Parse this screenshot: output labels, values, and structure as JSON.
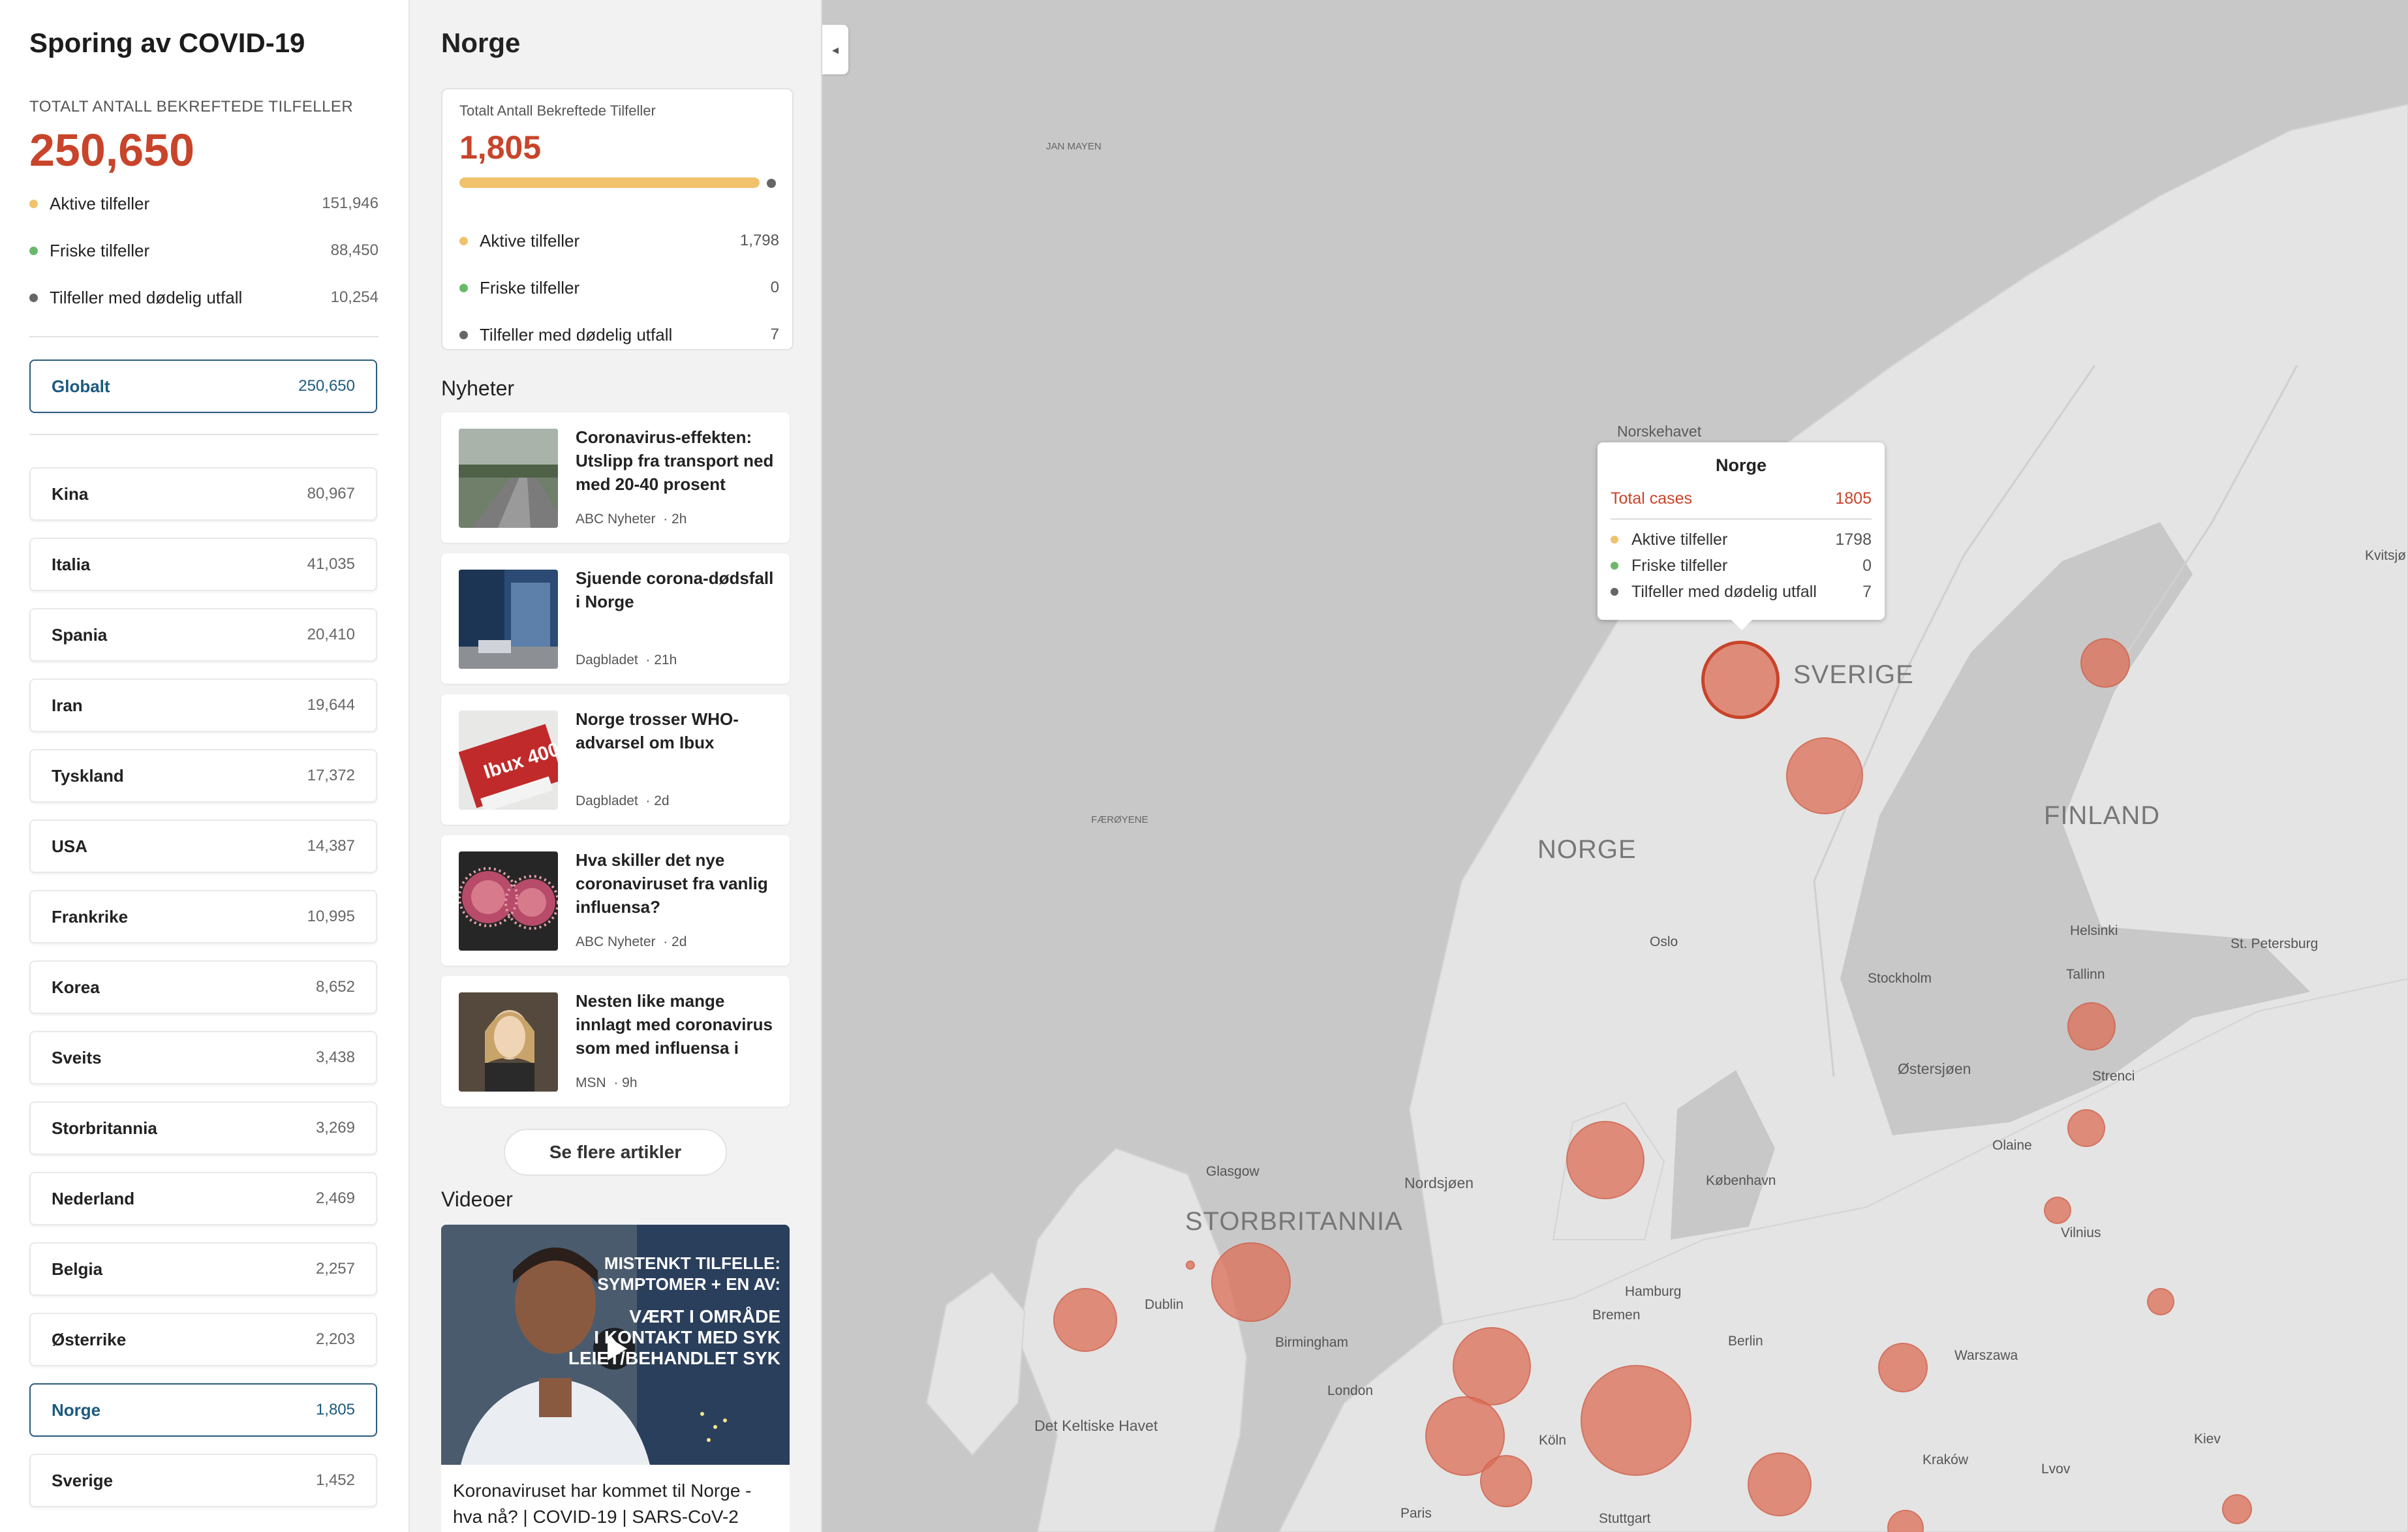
{
  "sidebar": {
    "title": "Sporing av COVID-19",
    "total_label": "TOTALT ANTALL BEKREFTEDE TILFELLER",
    "total_value": "250,650",
    "stats": [
      {
        "label": "Aktive tilfeller",
        "value": "151,946",
        "color": "#f0c26c"
      },
      {
        "label": "Friske tilfeller",
        "value": "88,450",
        "color": "#6ab86a"
      },
      {
        "label": "Tilfeller med dødelig utfall",
        "value": "10,254",
        "color": "#666666"
      }
    ],
    "global": {
      "label": "Globalt",
      "value": "250,650"
    },
    "countries": [
      {
        "name": "Kina",
        "value": "80,967"
      },
      {
        "name": "Italia",
        "value": "41,035"
      },
      {
        "name": "Spania",
        "value": "20,410"
      },
      {
        "name": "Iran",
        "value": "19,644"
      },
      {
        "name": "Tyskland",
        "value": "17,372"
      },
      {
        "name": "USA",
        "value": "14,387"
      },
      {
        "name": "Frankrike",
        "value": "10,995"
      },
      {
        "name": "Korea",
        "value": "8,652"
      },
      {
        "name": "Sveits",
        "value": "3,438"
      },
      {
        "name": "Storbritannia",
        "value": "3,269"
      },
      {
        "name": "Nederland",
        "value": "2,469"
      },
      {
        "name": "Belgia",
        "value": "2,257"
      },
      {
        "name": "Østerrike",
        "value": "2,203"
      },
      {
        "name": "Norge",
        "value": "1,805",
        "selected": true
      },
      {
        "name": "Sverige",
        "value": "1,452"
      }
    ]
  },
  "detail": {
    "title": "Norge",
    "card_label": "Totalt Antall Bekreftede Tilfeller",
    "card_value": "1,805",
    "active_fraction": 0.996,
    "stats": [
      {
        "label": "Aktive tilfeller",
        "value": "1,798",
        "color": "#f0c26c"
      },
      {
        "label": "Friske tilfeller",
        "value": "0",
        "color": "#6ab86a"
      },
      {
        "label": "Tilfeller med dødelig utfall",
        "value": "7",
        "color": "#666666"
      }
    ],
    "news_title": "Nyheter",
    "news": [
      {
        "headline": "Coronavirus-effekten: Utslipp fra transport ned med 20-40 prosent",
        "source": "ABC Nyheter",
        "age": "· 2h"
      },
      {
        "headline": "Sjuende corona-dødsfall i Norge",
        "source": "Dagbladet",
        "age": "· 21h"
      },
      {
        "headline": "Norge trosser WHO-advarsel om Ibux",
        "source": "Dagbladet",
        "age": "· 2d",
        "thumb_text": "Ibux 400"
      },
      {
        "headline": "Hva skiller det nye coronaviruset fra vanlig influensa?",
        "source": "ABC Nyheter",
        "age": "· 2d"
      },
      {
        "headline": "Nesten like mange innlagt med coronavirus som med influensa i",
        "source": "MSN",
        "age": "· 9h"
      }
    ],
    "more_button": "Se flere artikler",
    "videos_title": "Videoer",
    "video": {
      "title": "Koronaviruset har kommet til Norge - hva nå? | COVID-19 | SARS-CoV-2",
      "overlay_lines": [
        "MISTENKT TILFELLE:",
        "SYMPTOMER + EN AV:",
        "VÆRT I OMRÅDE",
        "I KONTAKT MED SYK",
        "LEIET/BEHANDLET SYK"
      ]
    }
  },
  "map": {
    "countries": [
      "SVERIGE",
      "NORGE",
      "FINLAND",
      "STORBRITANNIA"
    ],
    "seas": [
      "Norskehavet",
      "Nordsjøen",
      "Østersjøen",
      "Det Keltiske Havet"
    ],
    "islands": [
      "JAN MAYEN",
      "FÆRØYENE"
    ],
    "cities": [
      "Oslo",
      "Stockholm",
      "Helsinki",
      "Tallinn",
      "St. Petersburg",
      "Strenci",
      "Olaine",
      "Vilnius",
      "København",
      "Glasgow",
      "Dublin",
      "Birmingham",
      "London",
      "Hamburg",
      "Bremen",
      "Berlin",
      "Warszawa",
      "Köln",
      "Paris",
      "Stuttgart",
      "Kraków",
      "Lvov",
      "Kiev",
      "Kvitsjø"
    ],
    "tooltip": {
      "title": "Norge",
      "total_label": "Total cases",
      "total_value": "1805",
      "rows": [
        {
          "label": "Aktive tilfeller",
          "value": "1798",
          "color": "#f0c26c"
        },
        {
          "label": "Friske tilfeller",
          "value": "0",
          "color": "#6ab86a"
        },
        {
          "label": "Tilfeller med dødelig utfall",
          "value": "7",
          "color": "#666666"
        }
      ]
    },
    "colors": {
      "bubble": "#dc6e55",
      "land": "#e6e6e6",
      "water": "#c8c8c8",
      "accent": "#c8442a"
    }
  }
}
